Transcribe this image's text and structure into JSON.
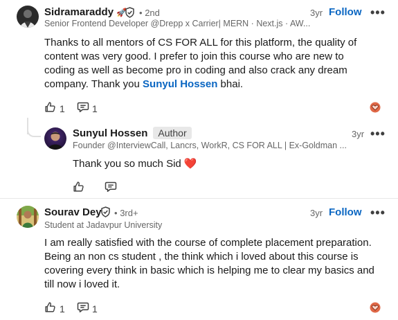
{
  "comments": [
    {
      "author": "Sidramaraddy",
      "author_emoji": "🚀",
      "degree": "2nd",
      "headline": "Senior Frontend Developer @Drepp x Carrier| MERN · Next.js · AW...",
      "time": "3yr",
      "follow_label": "Follow",
      "text_before": "Thanks to all mentors of CS FOR ALL for this platform, the quality of content was very good. I prefer to join this course who are new to coding as well as become pro in coding and also crack any dream company. Thank you ",
      "mention": "Sunyul Hossen",
      "text_after": " bhai.",
      "like_count": "1",
      "reply_count": "1",
      "reply": {
        "author": "Sunyul Hossen",
        "badge": "Author",
        "headline": "Founder @InterviewCall, Lancrs, WorkR, CS FOR ALL | Ex-Goldman ...",
        "time": "3yr",
        "text": "Thank you so much Sid ❤️"
      }
    },
    {
      "author": "Sourav Dey",
      "degree": "3rd+",
      "headline": "Student at Jadavpur University",
      "time": "3yr",
      "follow_label": "Follow",
      "text": "I am really satisfied with the course of complete placement preparation. Being an non cs student , the think which i loved about this course is covering every think in basic which is helping me to clear my basics and till now i loved it.",
      "like_count": "1",
      "reply_count": "1"
    }
  ],
  "icons": {
    "more": "more-options-icon",
    "like": "thumbs-up-icon",
    "reply": "comment-icon",
    "reaction": "love-reaction-icon",
    "verified": "verified-shield-icon"
  },
  "colors": {
    "accent": "#0a66c2",
    "reaction": "#e06847"
  },
  "separator": "•",
  "more_glyph": "•••"
}
